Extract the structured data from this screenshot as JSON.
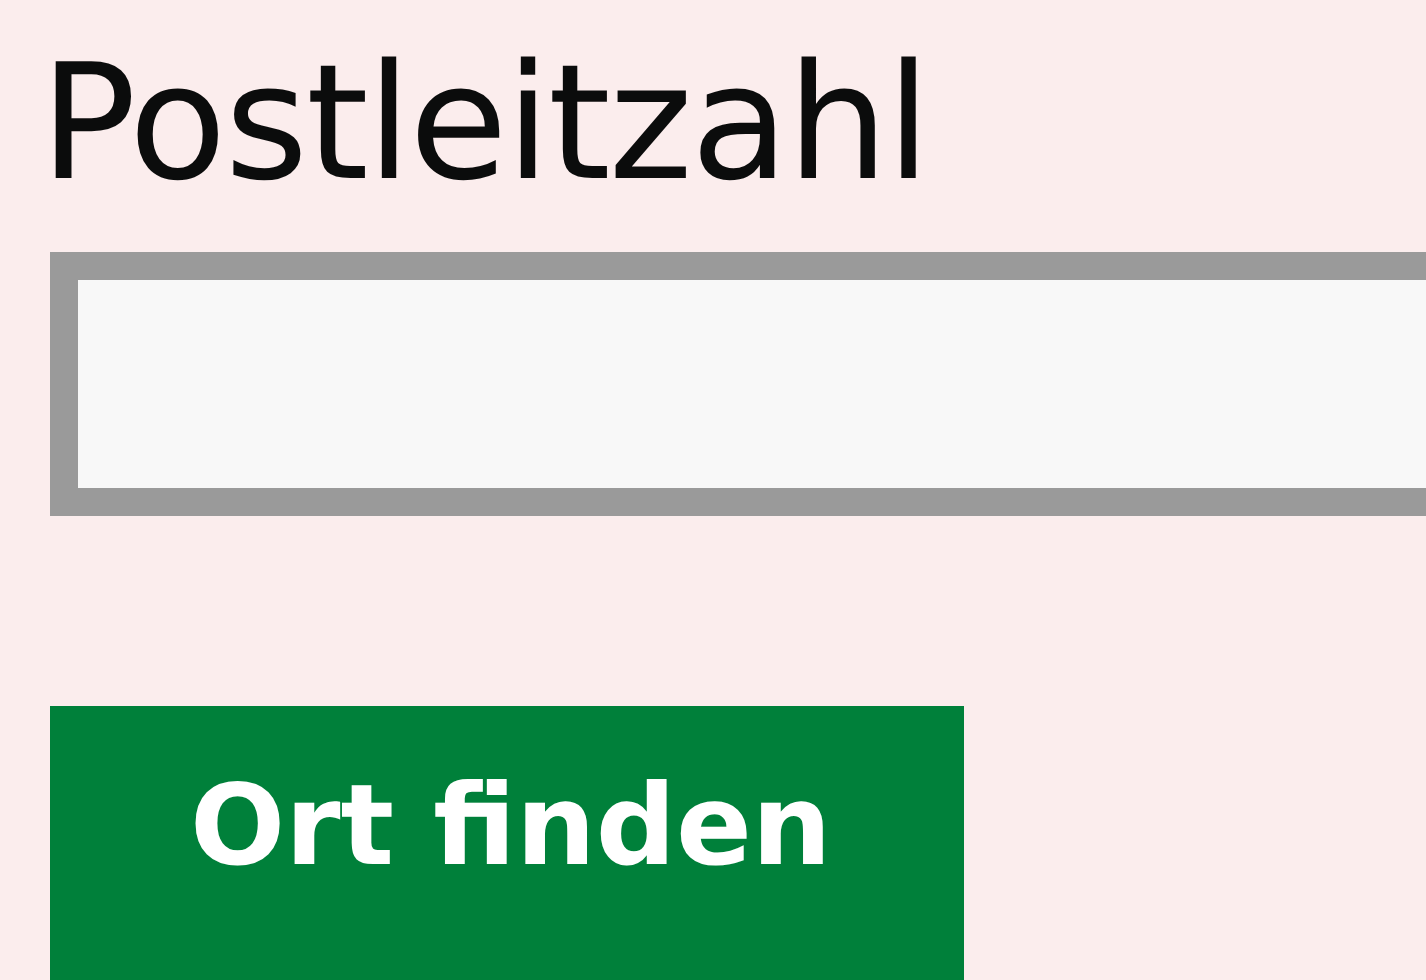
{
  "postcode_field": {
    "label": "Postleitzahl"
  },
  "submit_button": {
    "label": "Ort finden"
  }
}
